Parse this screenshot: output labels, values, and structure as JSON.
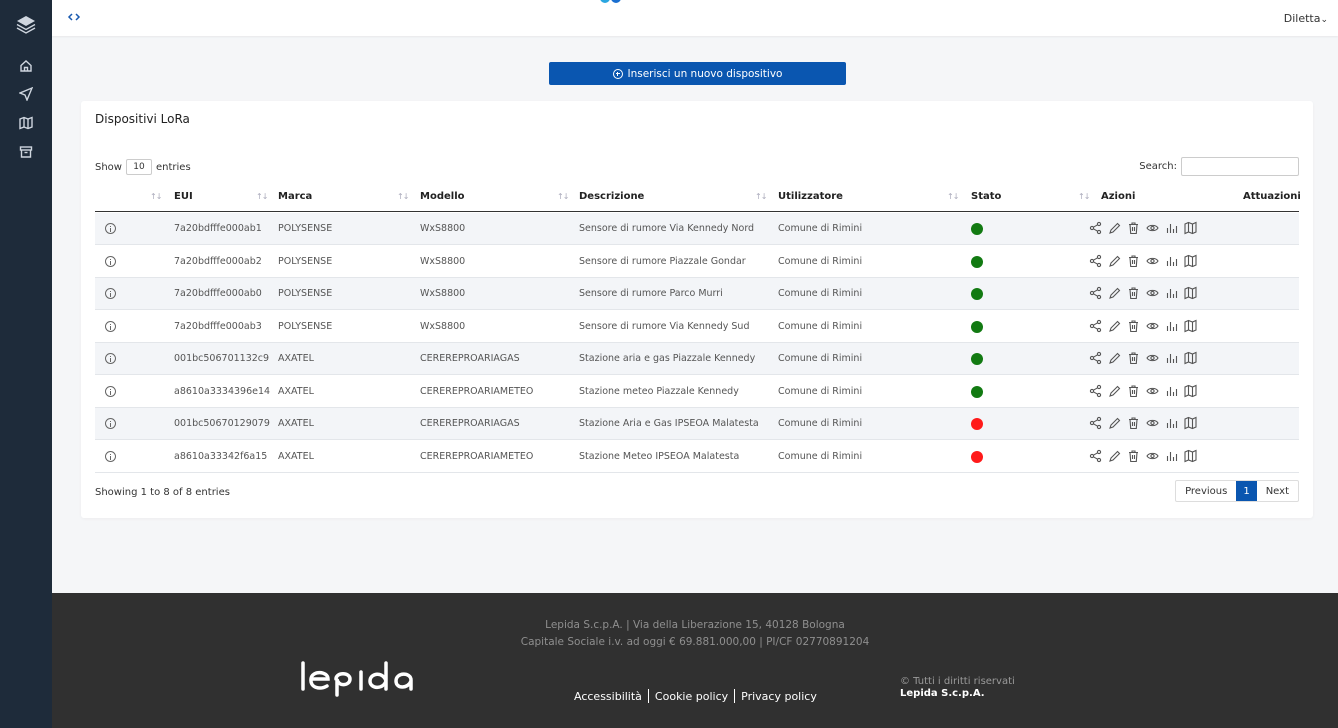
{
  "topbar": {
    "user": "Diletta",
    "user_caret": "⌄"
  },
  "new_device_label": "Inserisci un nuovo dispositivo",
  "card": {
    "title": "Dispositivi LoRa"
  },
  "table": {
    "show_label": "Show",
    "length_value": "10",
    "entries_label": "entries",
    "search_label": "Search:",
    "search_value": "",
    "sort_glyph": "↑↓",
    "columns": [
      "EUI",
      "Marca",
      "Modello",
      "Descrizione",
      "Utilizzatore",
      "Stato",
      "Azioni",
      "Attuazioni"
    ],
    "rows": [
      {
        "eui": "7a20bdfffe000ab1",
        "marca": "POLYSENSE",
        "modello": "WxS8800",
        "descrizione": "Sensore di rumore Via Kennedy Nord",
        "utilizzatore": "Comune di Rimini",
        "stato": "green"
      },
      {
        "eui": "7a20bdfffe000ab2",
        "marca": "POLYSENSE",
        "modello": "WxS8800",
        "descrizione": "Sensore di rumore Piazzale Gondar",
        "utilizzatore": "Comune di Rimini",
        "stato": "green"
      },
      {
        "eui": "7a20bdfffe000ab0",
        "marca": "POLYSENSE",
        "modello": "WxS8800",
        "descrizione": "Sensore di rumore Parco Murri",
        "utilizzatore": "Comune di Rimini",
        "stato": "green"
      },
      {
        "eui": "7a20bdfffe000ab3",
        "marca": "POLYSENSE",
        "modello": "WxS8800",
        "descrizione": "Sensore di rumore Via Kennedy Sud",
        "utilizzatore": "Comune di Rimini",
        "stato": "green"
      },
      {
        "eui": "001bc506701132c9",
        "marca": "AXATEL",
        "modello": "CEREREPROARIAGAS",
        "descrizione": "Stazione aria e gas Piazzale Kennedy",
        "utilizzatore": "Comune di Rimini",
        "stato": "green"
      },
      {
        "eui": "a8610a3334396e14",
        "marca": "AXATEL",
        "modello": "CEREREPROARIAMETEO",
        "descrizione": "Stazione meteo Piazzale Kennedy",
        "utilizzatore": "Comune di Rimini",
        "stato": "green"
      },
      {
        "eui": "001bc50670129079",
        "marca": "AXATEL",
        "modello": "CEREREPROARIAGAS",
        "descrizione": "Stazione Aria e Gas IPSEOA Malatesta",
        "utilizzatore": "Comune di Rimini",
        "stato": "red"
      },
      {
        "eui": "a8610a33342f6a15",
        "marca": "AXATEL",
        "modello": "CEREREPROARIAMETEO",
        "descrizione": "Stazione Meteo IPSEOA Malatesta",
        "utilizzatore": "Comune di Rimini",
        "stato": "red"
      }
    ],
    "info": "Showing 1 to 8 of 8 entries",
    "pagination": {
      "previous": "Previous",
      "current": "1",
      "next": "Next"
    }
  },
  "status_colors": {
    "green": "#127a12",
    "red": "#ff1a1a"
  },
  "footer": {
    "line1": "Lepida S.c.p.A. | Via della Liberazione 15, 40128 Bologna",
    "line2": "Capitale Sociale i.v. ad oggi € 69.881.000,00 | PI/CF 02770891204",
    "links": [
      "Accessibilità",
      "Cookie policy",
      "Privacy policy"
    ],
    "rights": "© Tutti i diritti riservati",
    "company": "Lepida S.c.p.A."
  }
}
